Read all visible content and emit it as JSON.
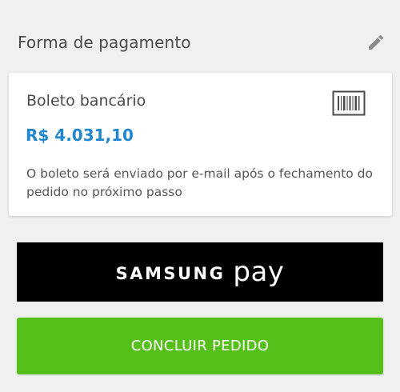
{
  "payment_section": {
    "title": "Forma de pagamento",
    "edit_icon": "pencil-icon"
  },
  "payment_card": {
    "method_name": "Boleto bancário",
    "method_icon": "barcode-icon",
    "amount": "R$ 4.031,10",
    "notice": "O boleto será enviado por e-mail após o fechamento do pedido no próximo passo"
  },
  "samsung_pay": {
    "brand": "SAMSUNG",
    "pay": "pay"
  },
  "conclude": {
    "label": "CONCLUIR PEDIDO"
  },
  "colors": {
    "background": "#f0f0f0",
    "amount_blue": "#1f86d0",
    "conclude_green": "#55c01a",
    "samsung_black": "#000000"
  }
}
